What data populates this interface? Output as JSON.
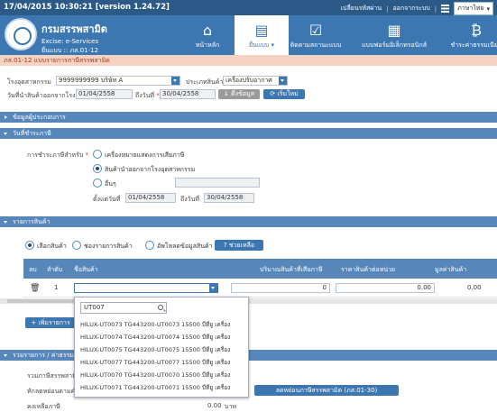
{
  "topbar": {
    "datetime": "17/04/2015 10:30:21",
    "version": "[version 1.24.72]",
    "menu_change_password": "เปลี่ยนรหัสผ่าน",
    "menu_logout": "ออกจากระบบ",
    "language": "ภาษาไทย"
  },
  "header": {
    "title": "กรมสรรพสามิต",
    "subtitle": "Excise: e-Services",
    "context": "ยื่นแบบ :: ภส.01-12",
    "nav": {
      "home": "หน้าหลัก",
      "submit": "ยื่นแบบ",
      "track": "ติดตามสถานะแบบ",
      "ebook": "แบบฟอร์มอิเล็กทรอนิกส์",
      "fee": "ชำระค่าธรรมเนียม"
    }
  },
  "breadcrumb": "ภส.01-12 แบบรายการภาษีสรรพสามิต",
  "form": {
    "factory_label": "โรงอุตสาหกรรม",
    "factory_value": "9999999999 บริษัท A",
    "product_type_label": "ประเภทสินค้า",
    "product_type_value": "เครื่องปรับอากาศ",
    "date_label": "วันที่นำสินค้าออกจากโรง",
    "date_from": "01/04/2558",
    "date_to_label": "ถึงวันที่",
    "date_to": "30/04/2558",
    "fetch_button": "ดึงข้อมูล",
    "reset_button": "เริ่มใหม่"
  },
  "sections": {
    "operator_info": "ข้อมูลผู้ประกอบการ",
    "tax_date": "วันที่ชำระภาษี",
    "product_list": "รายการสินค้า",
    "summary": "รวมรายการ / ค่าธรรมเนียม"
  },
  "tax_date": {
    "label": "การชำระภาษีสำหรับ",
    "opt_label_markup": "เครื่องหมายแสดงการเสียภาษี",
    "opt_export_from_factory": "สินค้านำออกจากโรงอุตสาหกรรม",
    "opt_other": "อื่นๆ",
    "from_label": "ตั้งแต่วันที่",
    "from_value": "01/04/2558",
    "to_label": "ถึงวันที่",
    "to_value": "30/04/2558"
  },
  "product_mode": {
    "opt_select": "เลือกสินค้า",
    "opt_manual": "ช่องรายการสินค้า",
    "opt_upload": "อัพโหลดข้อมูลสินค้า",
    "help_button": "ช่วยเหลือ"
  },
  "table": {
    "headers": [
      "ลบ",
      "ลำดับ",
      "ชื่อสินค้า",
      "ปริมาณสินค้าที่เสียภาษี",
      "ราคาสินค้าต่อหน่วย",
      "มูลค่าสินค้า"
    ],
    "row": {
      "seq": "1",
      "qty": "0",
      "unit_price": "0.00",
      "value": "0.00"
    }
  },
  "add_item_button": "เพิ่มรายการ",
  "summary": {
    "total_tax_label": "รวมภาษีสรรพสามิต",
    "deduct_label": "หักลดหย่อนตามคำขอ",
    "remaining_label": "คงเหลือภาษี",
    "remaining_value": "0.00",
    "remaining_unit": "บาท",
    "deduct_link": "ลดหย่อนภาษีสรรพสามิต (ภส.01-30)"
  },
  "dropdown": {
    "search_value": "UT007",
    "items": [
      "HILUX-UT0073 TG443200-UT0073 15500 บีทียู เครื่อง",
      "HILUX-UT0074 TG443200-UT0074 15500 บีทียู เครื่อง",
      "HILUX-UT0075 TG443200-UT0075 15500 บีทียู เครื่อง",
      "HILUX-UT0077 TG443200-UT0077 15500 บีทียู เครื่อง",
      "HILUX-UT0070 TG443200-UT0070 15500 บีทียู เครื่อง",
      "HILUX-UT0071 TG443200-UT0071 15500 บีทียู เครื่อง"
    ]
  }
}
